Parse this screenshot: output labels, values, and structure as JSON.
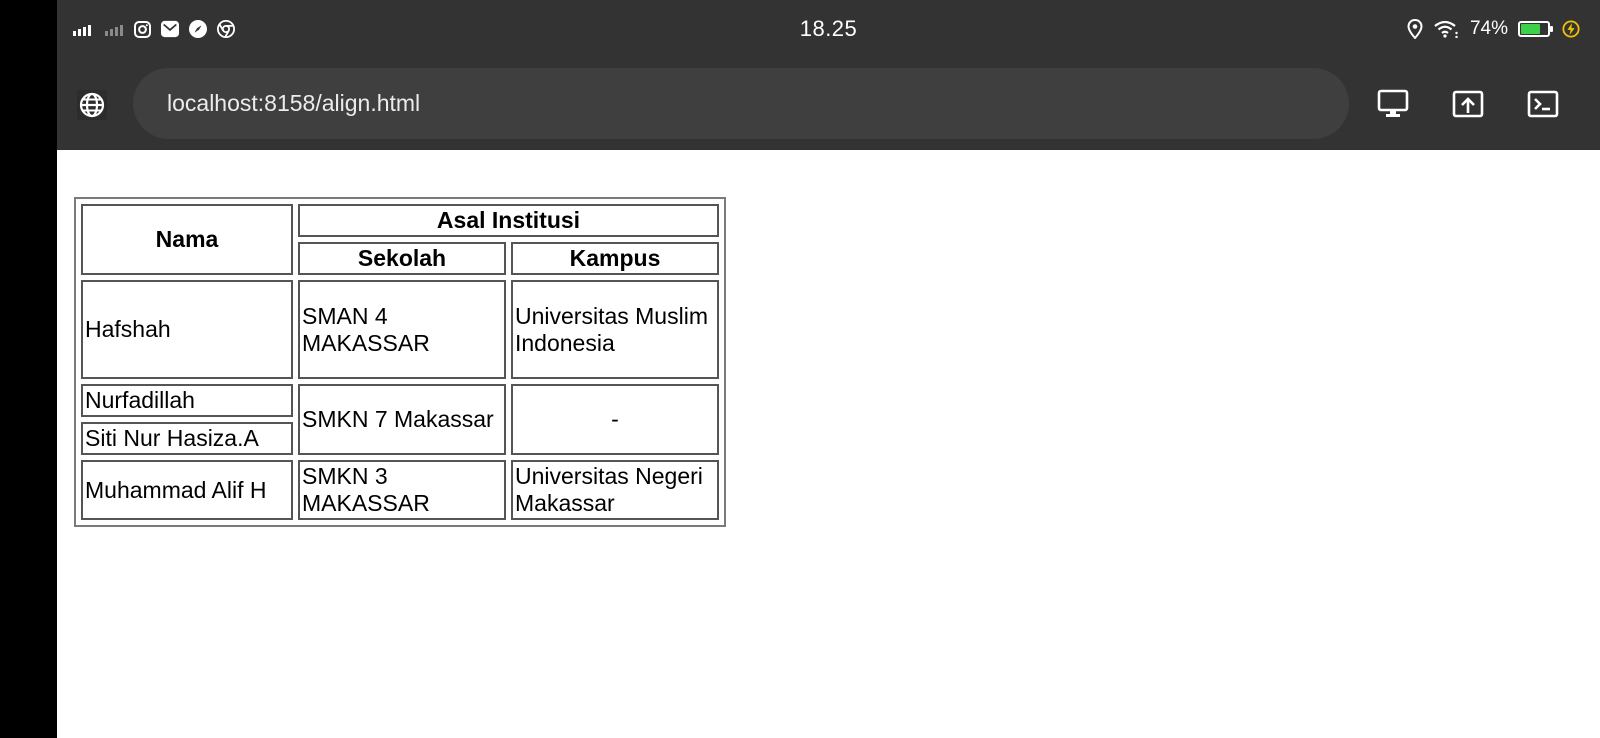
{
  "status_bar": {
    "time": "18.25",
    "battery_percent": "74%",
    "battery_level": 0.74,
    "icons": [
      "signal-icon",
      "signal-weak-icon",
      "instagram-icon",
      "gmail-icon",
      "compass-icon",
      "chrome-icon",
      "location-icon",
      "wifi-icon",
      "battery-icon",
      "charging-icon"
    ],
    "battery_color": "#3dd14a",
    "charging_color": "#f2c200"
  },
  "browser": {
    "url": "localhost:8158/align.html",
    "toolbar_icons": [
      "desktop-site-icon",
      "share-icon",
      "terminal-icon"
    ]
  },
  "table": {
    "header": {
      "nama": "Nama",
      "asal_institusi": "Asal Institusi",
      "sekolah": "Sekolah",
      "kampus": "Kampus"
    },
    "rows": [
      {
        "nama": "Hafshah",
        "sekolah": "SMAN 4 MAKASSAR",
        "kampus": "Universitas Muslim Indonesia"
      },
      {
        "nama": "Nurfadillah",
        "sekolah": "SMKN 7 Makassar",
        "kampus": "-"
      },
      {
        "nama": "Siti Nur Hasiza.A"
      },
      {
        "nama": "Muhammad Alif H",
        "sekolah": "SMKN 3 MAKASSAR",
        "kampus": "Universitas Negeri Makassar"
      }
    ]
  }
}
